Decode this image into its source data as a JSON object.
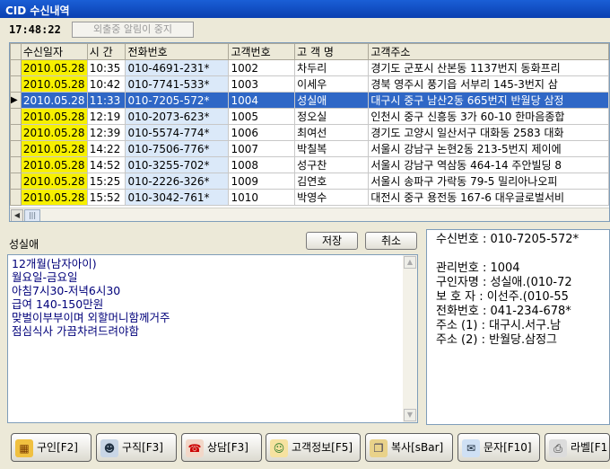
{
  "window": {
    "title": "CID 수신내역"
  },
  "toolbar": {
    "clock": "17:48:22",
    "stop_label": "외출중 알림이 중지"
  },
  "grid": {
    "headers": [
      "수신일자",
      "시 간",
      "전화번호",
      "고객번호",
      "고 객 명",
      "고객주소"
    ],
    "rows": [
      [
        "2010.05.28",
        "10:35",
        "010-4691-231*",
        "1002",
        "차두리",
        "경기도 군포시 산본동 1137번지 동화프리"
      ],
      [
        "2010.05.28",
        "10:42",
        "010-7741-533*",
        "1003",
        "이세우",
        "경북 영주시 풍기읍 서부리 145-3번지 삼"
      ],
      [
        "2010.05.28",
        "11:33",
        "010-7205-572*",
        "1004",
        "성실애",
        "대구시 중구 남산2동 665번지 반월당 삼정"
      ],
      [
        "2010.05.28",
        "12:19",
        "010-2073-623*",
        "1005",
        "정오실",
        "인천시 중구 신흥동 3가 60-10 한마음종합"
      ],
      [
        "2010.05.28",
        "12:39",
        "010-5574-774*",
        "1006",
        "최여선",
        "경기도 고양시 일산서구 대화동 2583 대화"
      ],
      [
        "2010.05.28",
        "14:22",
        "010-7506-776*",
        "1007",
        "박칠복",
        "서울시 강남구 논현2동 213-5번지 제이에"
      ],
      [
        "2010.05.28",
        "14:52",
        "010-3255-702*",
        "1008",
        "성구찬",
        "서울시 강남구 역삼동 464-14 주안빌딩 8"
      ],
      [
        "2010.05.28",
        "15:25",
        "010-2226-326*",
        "1009",
        "김연호",
        "서울시 송파구 가락동 79-5 밀리아나오피"
      ],
      [
        "2010.05.28",
        "15:52",
        "010-3042-761*",
        "1010",
        "박영수",
        "대전시 중구 용전동 167-6 대우글로벌서비"
      ]
    ],
    "selected_index": 2,
    "colors": {
      "date_bg": "#f7f000",
      "phone_bg": "#dbe9f9",
      "selected_bg": "#2f67c6"
    }
  },
  "memo": {
    "customer_name": "성실애",
    "save_label": "저장",
    "cancel_label": "취소",
    "lines": [
      "12개월(남자아이)",
      "월요일-금요일",
      "아침7시30-저녁6시30",
      "급여 140-150만원",
      "",
      "맞벌이부부이며 외할머니함께거주",
      "점심식사 가끔차려드려야함"
    ]
  },
  "info": {
    "rows": [
      "수신번호 : 010-7205-572*",
      "",
      "관리번호 : 1004",
      "구인자명 : 성실애.(010-72",
      "보 호 자 : 이선주.(010-55",
      "전화번호 : 041-234-678*",
      "주소 (1) : 대구시.서구.남",
      "주소 (2) : 반월당.삼정그"
    ]
  },
  "actions": [
    {
      "label": "구인[F2]",
      "icon": "job-offer-icon"
    },
    {
      "label": "구직[F3]",
      "icon": "job-seek-icon"
    },
    {
      "label": "상담[F3]",
      "icon": "consult-phone-icon"
    },
    {
      "label": "고객정보[F5]",
      "icon": "customer-info-icon"
    },
    {
      "label": "복사[sBar]",
      "icon": "copy-icon"
    },
    {
      "label": "문자[F10]",
      "icon": "sms-icon"
    },
    {
      "label": "라벨[F1",
      "icon": "label-printer-icon"
    }
  ]
}
